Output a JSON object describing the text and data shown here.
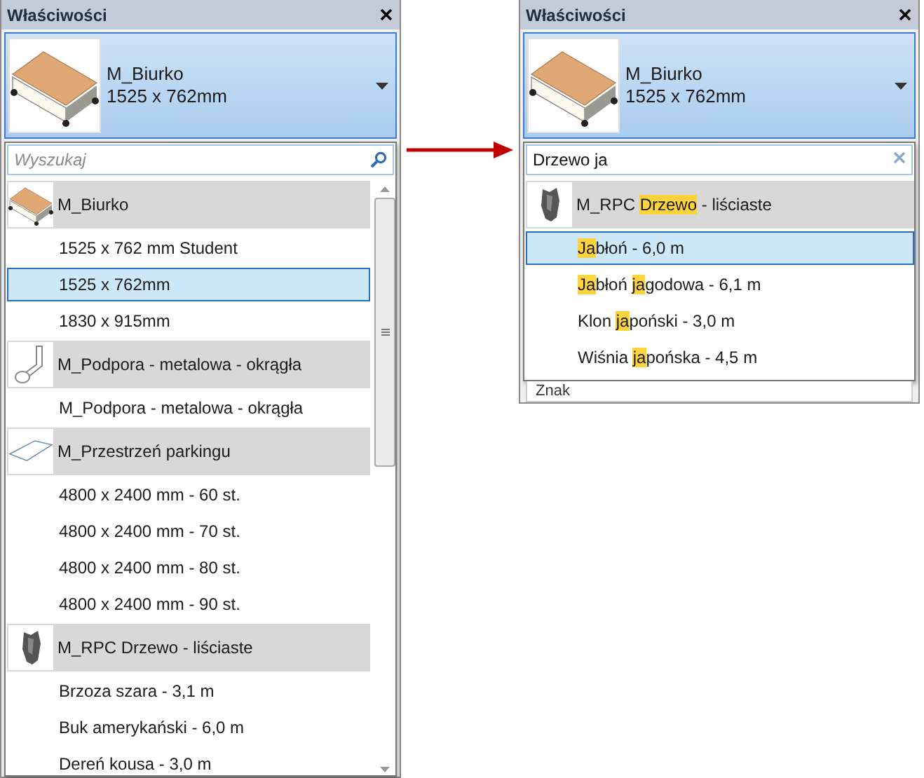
{
  "panels": [
    {
      "title": "Właściwości",
      "type_selector": {
        "name": "M_Biurko",
        "size": "1525 x 762mm"
      },
      "search": {
        "placeholder": "Wyszukaj"
      },
      "scrollbar": true,
      "groups": [
        {
          "kind": "desk",
          "name": [
            {
              "text": "M_Biurko",
              "hl": false
            }
          ],
          "items": [
            {
              "parts": [
                {
                  "text": "1525 x 762 mm Student",
                  "hl": false
                }
              ],
              "selected": false
            },
            {
              "parts": [
                {
                  "text": "1525 x 762mm",
                  "hl": false
                }
              ],
              "selected": true
            },
            {
              "parts": [
                {
                  "text": "1830 x 915mm",
                  "hl": false
                }
              ],
              "selected": false
            }
          ]
        },
        {
          "kind": "support",
          "name": [
            {
              "text": "M_Podpora - metalowa - okrągła",
              "hl": false
            }
          ],
          "items": [
            {
              "parts": [
                {
                  "text": "M_Podpora - metalowa - okrągła",
                  "hl": false
                }
              ],
              "selected": false
            }
          ]
        },
        {
          "kind": "parking",
          "name": [
            {
              "text": "M_Przestrzeń parkingu",
              "hl": false
            }
          ],
          "items": [
            {
              "parts": [
                {
                  "text": "4800 x 2400 mm - 60 st.",
                  "hl": false
                }
              ],
              "selected": false
            },
            {
              "parts": [
                {
                  "text": "4800 x 2400 mm - 70 st.",
                  "hl": false
                }
              ],
              "selected": false
            },
            {
              "parts": [
                {
                  "text": "4800 x 2400 mm - 80 st.",
                  "hl": false
                }
              ],
              "selected": false
            },
            {
              "parts": [
                {
                  "text": "4800 x 2400 mm - 90 st.",
                  "hl": false
                }
              ],
              "selected": false
            }
          ]
        },
        {
          "kind": "tree",
          "name": [
            {
              "text": "M_RPC Drzewo - liściaste",
              "hl": false
            }
          ],
          "items": [
            {
              "parts": [
                {
                  "text": "Brzoza szara - 3,1 m",
                  "hl": false
                }
              ],
              "selected": false
            },
            {
              "parts": [
                {
                  "text": "Buk amerykański - 6,0 m",
                  "hl": false
                }
              ],
              "selected": false
            },
            {
              "parts": [
                {
                  "text": "Dereń kousa - 3,0 m",
                  "hl": false
                }
              ],
              "selected": false
            }
          ]
        }
      ]
    },
    {
      "title": "Właściwości",
      "type_selector": {
        "name": "M_Biurko",
        "size": "1525 x 762mm"
      },
      "search": {
        "value": "Drzewo ja"
      },
      "scrollbar": false,
      "background_rows": [
        "Znak"
      ],
      "groups": [
        {
          "kind": "tree",
          "name": [
            {
              "text": "M_RPC ",
              "hl": false
            },
            {
              "text": "Drzewo",
              "hl": true
            },
            {
              "text": " - liściaste",
              "hl": false
            }
          ],
          "items": [
            {
              "parts": [
                {
                  "text": "Ja",
                  "hl": true
                },
                {
                  "text": "błoń - 6,0 m",
                  "hl": false
                }
              ],
              "selected": true
            },
            {
              "parts": [
                {
                  "text": "Ja",
                  "hl": true
                },
                {
                  "text": "błoń ",
                  "hl": false
                },
                {
                  "text": "ja",
                  "hl": true
                },
                {
                  "text": "godowa - 6,1 m",
                  "hl": false
                }
              ],
              "selected": false
            },
            {
              "parts": [
                {
                  "text": "Klon ",
                  "hl": false
                },
                {
                  "text": "ja",
                  "hl": true
                },
                {
                  "text": "poński - 3,0 m",
                  "hl": false
                }
              ],
              "selected": false
            },
            {
              "parts": [
                {
                  "text": "Wiśnia ",
                  "hl": false
                },
                {
                  "text": "ja",
                  "hl": true
                },
                {
                  "text": "pońska - 4,5 m",
                  "hl": false
                }
              ],
              "selected": false
            }
          ]
        }
      ]
    }
  ]
}
